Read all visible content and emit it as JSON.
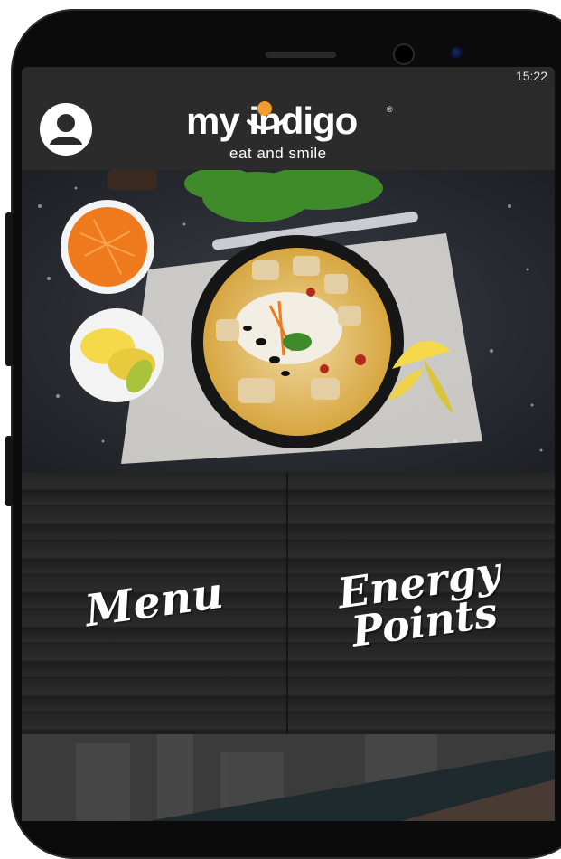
{
  "status_bar": {
    "time": "15:22"
  },
  "header": {
    "logo_text": "my indigo",
    "tagline": "eat and smile",
    "profile_icon": "user-profile-icon"
  },
  "hero": {
    "image_icon": "food-bowl-photo"
  },
  "tiles": [
    {
      "label": "Menu"
    },
    {
      "label": "Energy Points"
    }
  ],
  "colors": {
    "appbar_bg": "#2b2b2b",
    "logo_accent": "#f39a2b",
    "text": "#ffffff"
  }
}
